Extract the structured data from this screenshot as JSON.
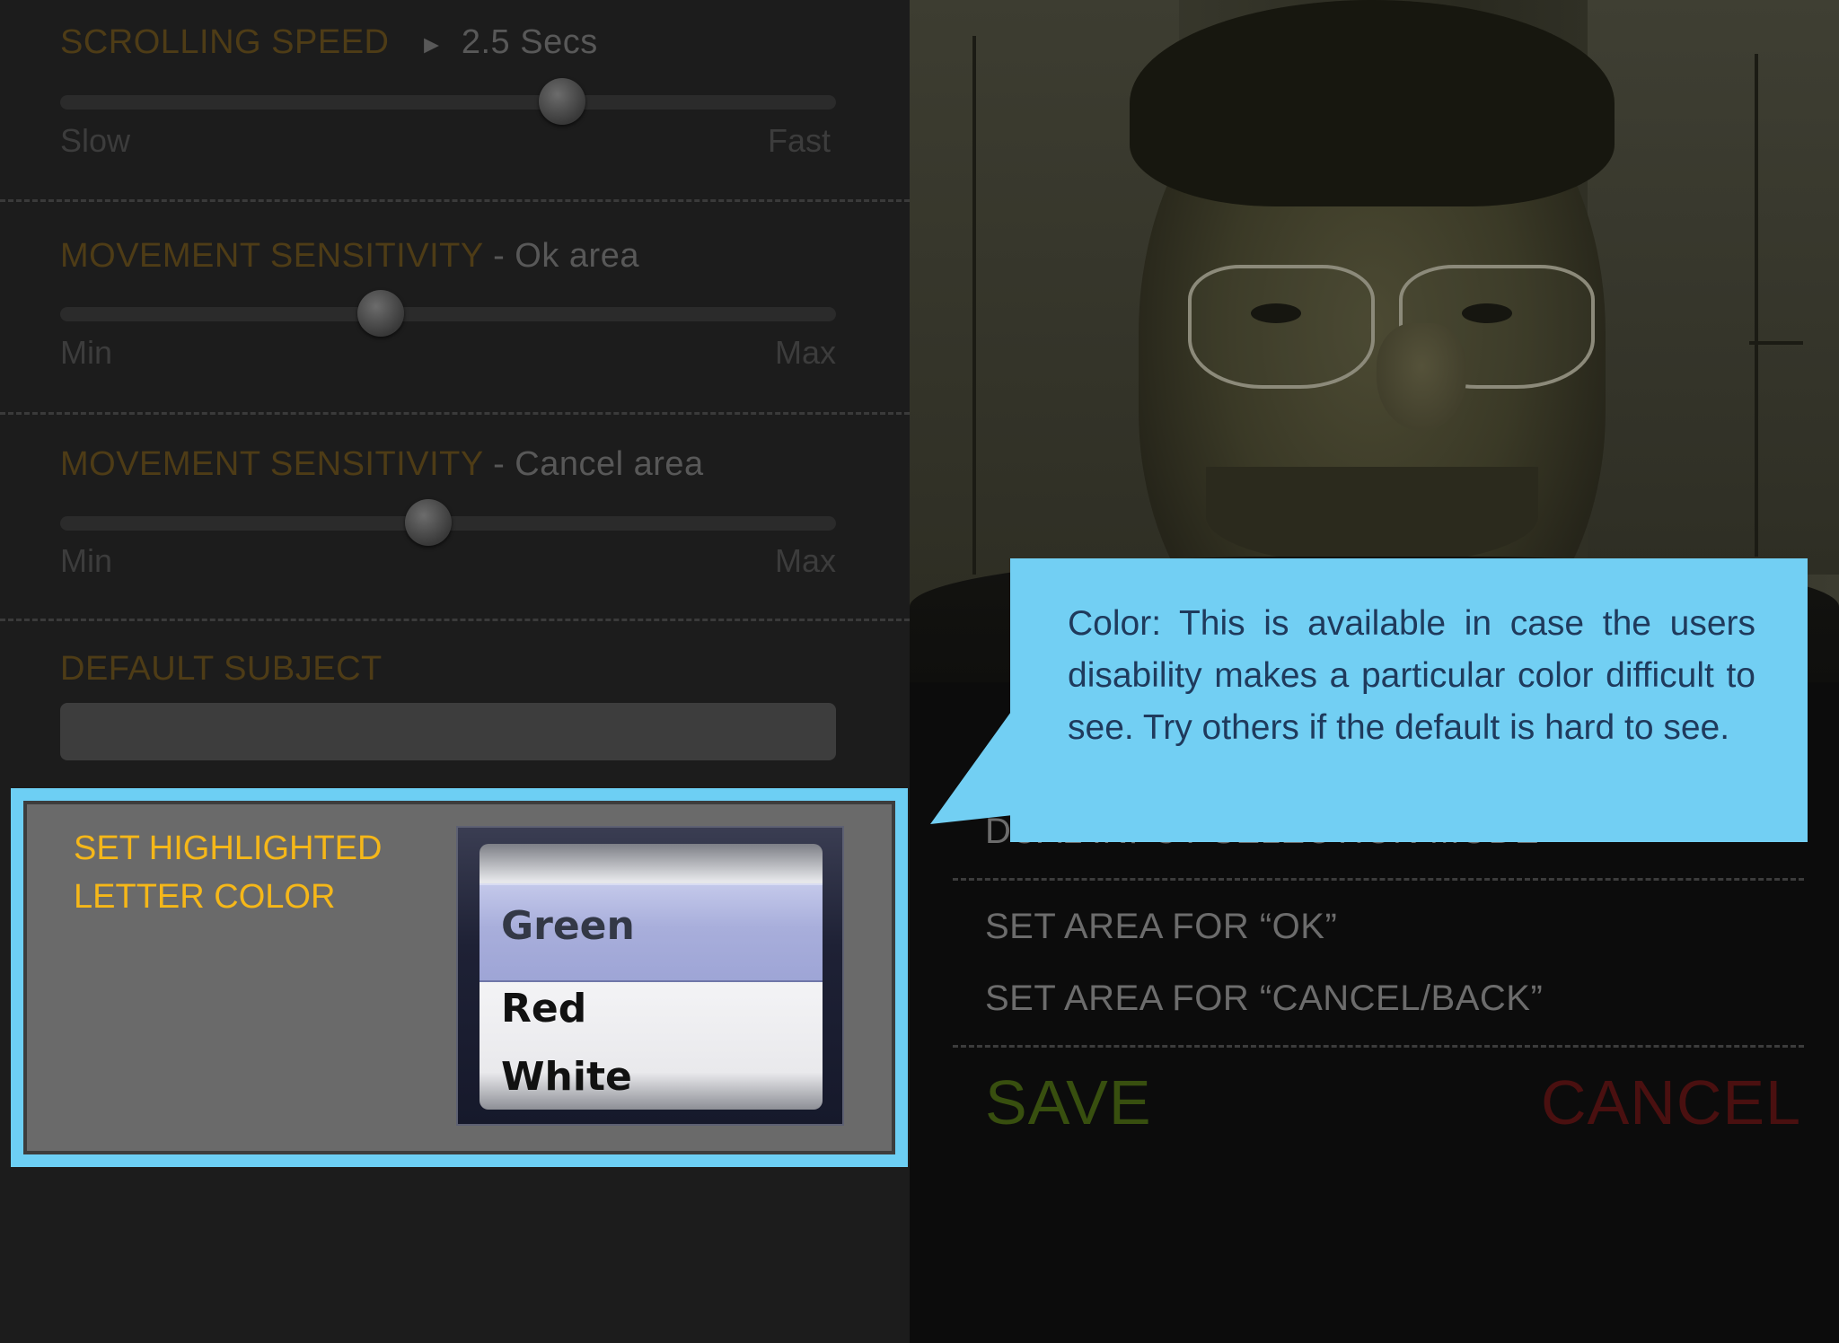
{
  "settings": {
    "scrolling_speed": {
      "title": "SCROLLING SPEED",
      "arrow": "►",
      "value": "2.5 Secs",
      "min_label": "Slow",
      "max_label": "Fast",
      "level": 0.65
    },
    "movement_ok": {
      "title": "MOVEMENT SENSITIVITY",
      "suffix": "- Ok area",
      "min_label": "Min",
      "max_label": "Max",
      "level": 0.41
    },
    "movement_cancel": {
      "title": "MOVEMENT SENSITIVITY",
      "suffix": "- Cancel area",
      "min_label": "Min",
      "max_label": "Max",
      "level": 0.47
    },
    "default_subject": {
      "title": "DEFAULT SUBJECT",
      "value": ""
    },
    "highlight_color": {
      "label_line1": "SET HIGHLIGHTED",
      "label_line2": "LETTER COLOR",
      "options": [
        "Green",
        "Red",
        "White"
      ],
      "selected": "Green"
    }
  },
  "right_menu": {
    "partial_item": "DUAL INPUT SELECTION MODE",
    "set_ok": "SET AREA FOR “OK”",
    "set_cancel": "SET AREA FOR “CANCEL/BACK”",
    "save": "SAVE",
    "cancel": "CANCEL"
  },
  "callout": {
    "text": "Color:  This is available in case the users disability makes a particular color difficult to see. Try others if the default is hard to see."
  },
  "colors": {
    "accent_blue": "#6dcff4",
    "label_amber": "#f5b719",
    "save_green": "#384f0f",
    "cancel_red": "#4a1010"
  }
}
